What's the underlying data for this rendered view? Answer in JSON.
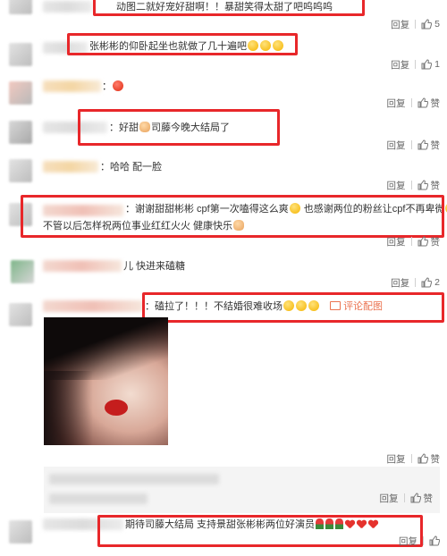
{
  "colors": {
    "highlight_box": "#e8272a",
    "pic_link": "#eb7350",
    "meta_text": "#666666"
  },
  "actions": {
    "reply_label": "回复",
    "like_label": "赞"
  },
  "comments": [
    {
      "text": "动图二就好宠好甜啊！！暴甜笑得太甜了吧呜呜呜",
      "like_count": "5"
    },
    {
      "text": "张彬彬的仰卧起坐也就做了几十遍吧",
      "like_count": "1"
    },
    {
      "text": "：",
      "like_count": ""
    },
    {
      "text": "：好甜",
      "text_after": "司藤今晚大结局了",
      "like_count": ""
    },
    {
      "text": "：哈哈 配一脸",
      "like_count": ""
    },
    {
      "text": "：谢谢甜甜彬彬 cpf第一次嗑得这么爽",
      "text_mid": "也感谢两位的粉丝让cpf不再卑微",
      "text_line2": "不管以后怎样祝两位事业红红火火 健康快乐",
      "like_count": ""
    },
    {
      "text": "儿 快进来磕糖",
      "like_count": "2"
    },
    {
      "text": "：磕拉了！！！不结婚很难收场",
      "pic_link": "评论配图",
      "like_count": ""
    },
    {
      "text": "期待司藤大结局 支持景甜张彬彬两位好演员",
      "like_count": ""
    }
  ]
}
